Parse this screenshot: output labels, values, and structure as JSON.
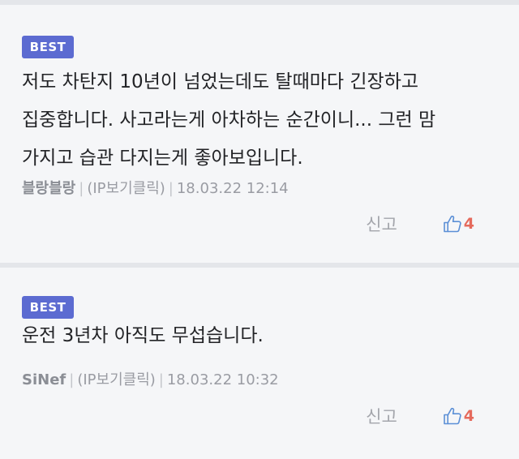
{
  "comments": [
    {
      "badge": "BEST",
      "body_lines": [
        "저도 차탄지 10년이 넘었는데도 탈때마다 긴장하고",
        "집중합니다. 사고라는게 아차하는 순간이니... 그런 맘",
        "가지고 습관 다지는게 좋아보입니다."
      ],
      "author": "블랑블랑",
      "ip_label": "(IP보기클릭)",
      "timestamp": "18.03.22 12:14",
      "report_label": "신고",
      "like_count": "4"
    },
    {
      "badge": "BEST",
      "body_lines": [
        "운전 3년차 아직도 무섭습니다."
      ],
      "author": "SiNef",
      "ip_label": "(IP보기클릭)",
      "timestamp": "18.03.22 10:32",
      "report_label": "신고",
      "like_count": "4"
    }
  ],
  "separator": "|",
  "colors": {
    "badge_bg": "#5c6bd1",
    "like_icon": "#5b8fd6",
    "like_count": "#e56a5c",
    "page_bg": "#f5f6f8"
  },
  "icons": {
    "like": "thumbs-up-icon"
  }
}
